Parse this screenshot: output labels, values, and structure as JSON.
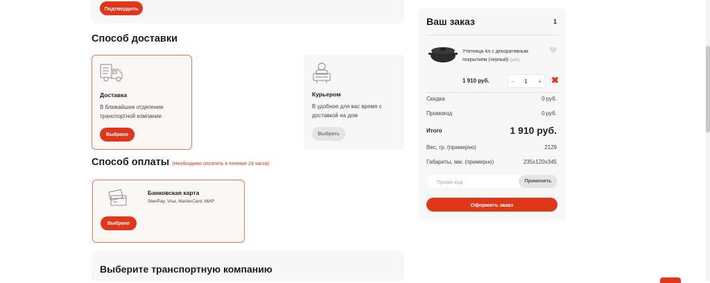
{
  "top": {
    "confirm_label": "Подтвердить"
  },
  "delivery": {
    "title": "Способ доставки",
    "options": [
      {
        "title": "Доставка",
        "desc1": "В ближайшее отделение",
        "desc2": "транспортной компании",
        "button": "Выбрано",
        "icon": "delivery-truck-icon",
        "selected": true
      },
      {
        "title": "Курьером",
        "desc1": "В удобное для вас время с",
        "desc2": "доставкой на дом",
        "button": "Выбрать",
        "icon": "courier-icon",
        "selected": false
      }
    ]
  },
  "payment": {
    "title": "Способ оплаты",
    "note": "(Необходимо оплатить в течение 24 часов)",
    "option": {
      "title": "Банковская карта",
      "desc": "SberPay, Visa, MasterCard, МИР",
      "button": "Выбрано",
      "icon": "bank-card-icon"
    }
  },
  "transport": {
    "title": "Выберите транспортную компанию"
  },
  "order": {
    "title": "Ваш заказ",
    "count": "1",
    "product": {
      "name": "Утятница 4л с декоративным покрытием (черный)",
      "article": "(у43)",
      "price": "1 910 руб.",
      "quantity": "1",
      "minus": "-",
      "plus": "+",
      "remove": "✖",
      "image": "roasting-pan-image",
      "favorite_icon": "heart-icon"
    },
    "rows": [
      {
        "label": "Скидка",
        "value": "0 руб."
      },
      {
        "label": "Промокод",
        "value": "0 руб."
      }
    ],
    "total_label": "Итого",
    "total_value": "1 910 руб.",
    "specs": [
      {
        "label": "Вес, гр. (примерно)",
        "value": "2129"
      },
      {
        "label": "Габариты, мм. (примерно)",
        "value": "235x120x345"
      }
    ],
    "promo_placeholder": "Промо-код",
    "promo_button": "Применить",
    "checkout_button": "Оформить заказ"
  },
  "colors": {
    "accent": "#e2361b",
    "card_bg": "#f7f7f7",
    "selected_border": "#e8765f"
  }
}
